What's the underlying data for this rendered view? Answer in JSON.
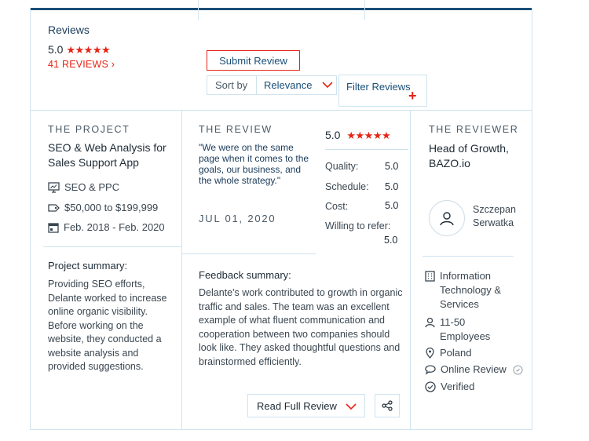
{
  "header": {
    "title": "Reviews",
    "rating": "5.0",
    "stars": "★★★★★",
    "reviews_link": "41 REVIEWS ›",
    "submit_label": "Submit Review",
    "sort_label": "Sort by",
    "sort_value": "Relevance",
    "filter_label": "Filter Reviews",
    "filter_plus": "+"
  },
  "project": {
    "caption": "THE PROJECT",
    "title": "SEO & Web Analysis for Sales Support App",
    "service": "SEO & PPC",
    "budget": "$50,000 to $199,999",
    "dates": "Feb. 2018 - Feb. 2020",
    "summary_heading": "Project summary:",
    "summary_text": "Providing SEO efforts, Delante worked to increase online organic visibility. Before working on the website, they conducted a website analysis and provided suggestions."
  },
  "review": {
    "caption": "THE REVIEW",
    "quote": "\"We were on the same page when it comes to the goals, our business, and the whole strategy.\"",
    "date": "JUL 01, 2020",
    "overall": "5.0",
    "stars": "★★★★★",
    "scores": [
      {
        "label": "Quality:",
        "value": "5.0"
      },
      {
        "label": "Schedule:",
        "value": "5.0"
      },
      {
        "label": "Cost:",
        "value": "5.0"
      },
      {
        "label": "Willing to refer:",
        "value": "5.0"
      }
    ],
    "feedback_heading": "Feedback summary:",
    "feedback_text": "Delante's work contributed to growth in organic traffic and sales. The team was an excellent example of what fluent communication and cooperation between two companies should look like. They asked thoughtful questions and brainstormed efficiently.",
    "read_full_label": "Read Full Review"
  },
  "reviewer": {
    "caption": "THE REVIEWER",
    "title": "Head of Growth, BAZO.io",
    "name": "Szczepan Serwatka",
    "industry": "Information Technology & Services",
    "size": "11-50 Employees",
    "location": "Poland",
    "review_type": "Online Review",
    "status": "Verified"
  },
  "colors": {
    "accent": "#e62415",
    "brand": "#1a4f78",
    "border": "#cfe3ee"
  }
}
